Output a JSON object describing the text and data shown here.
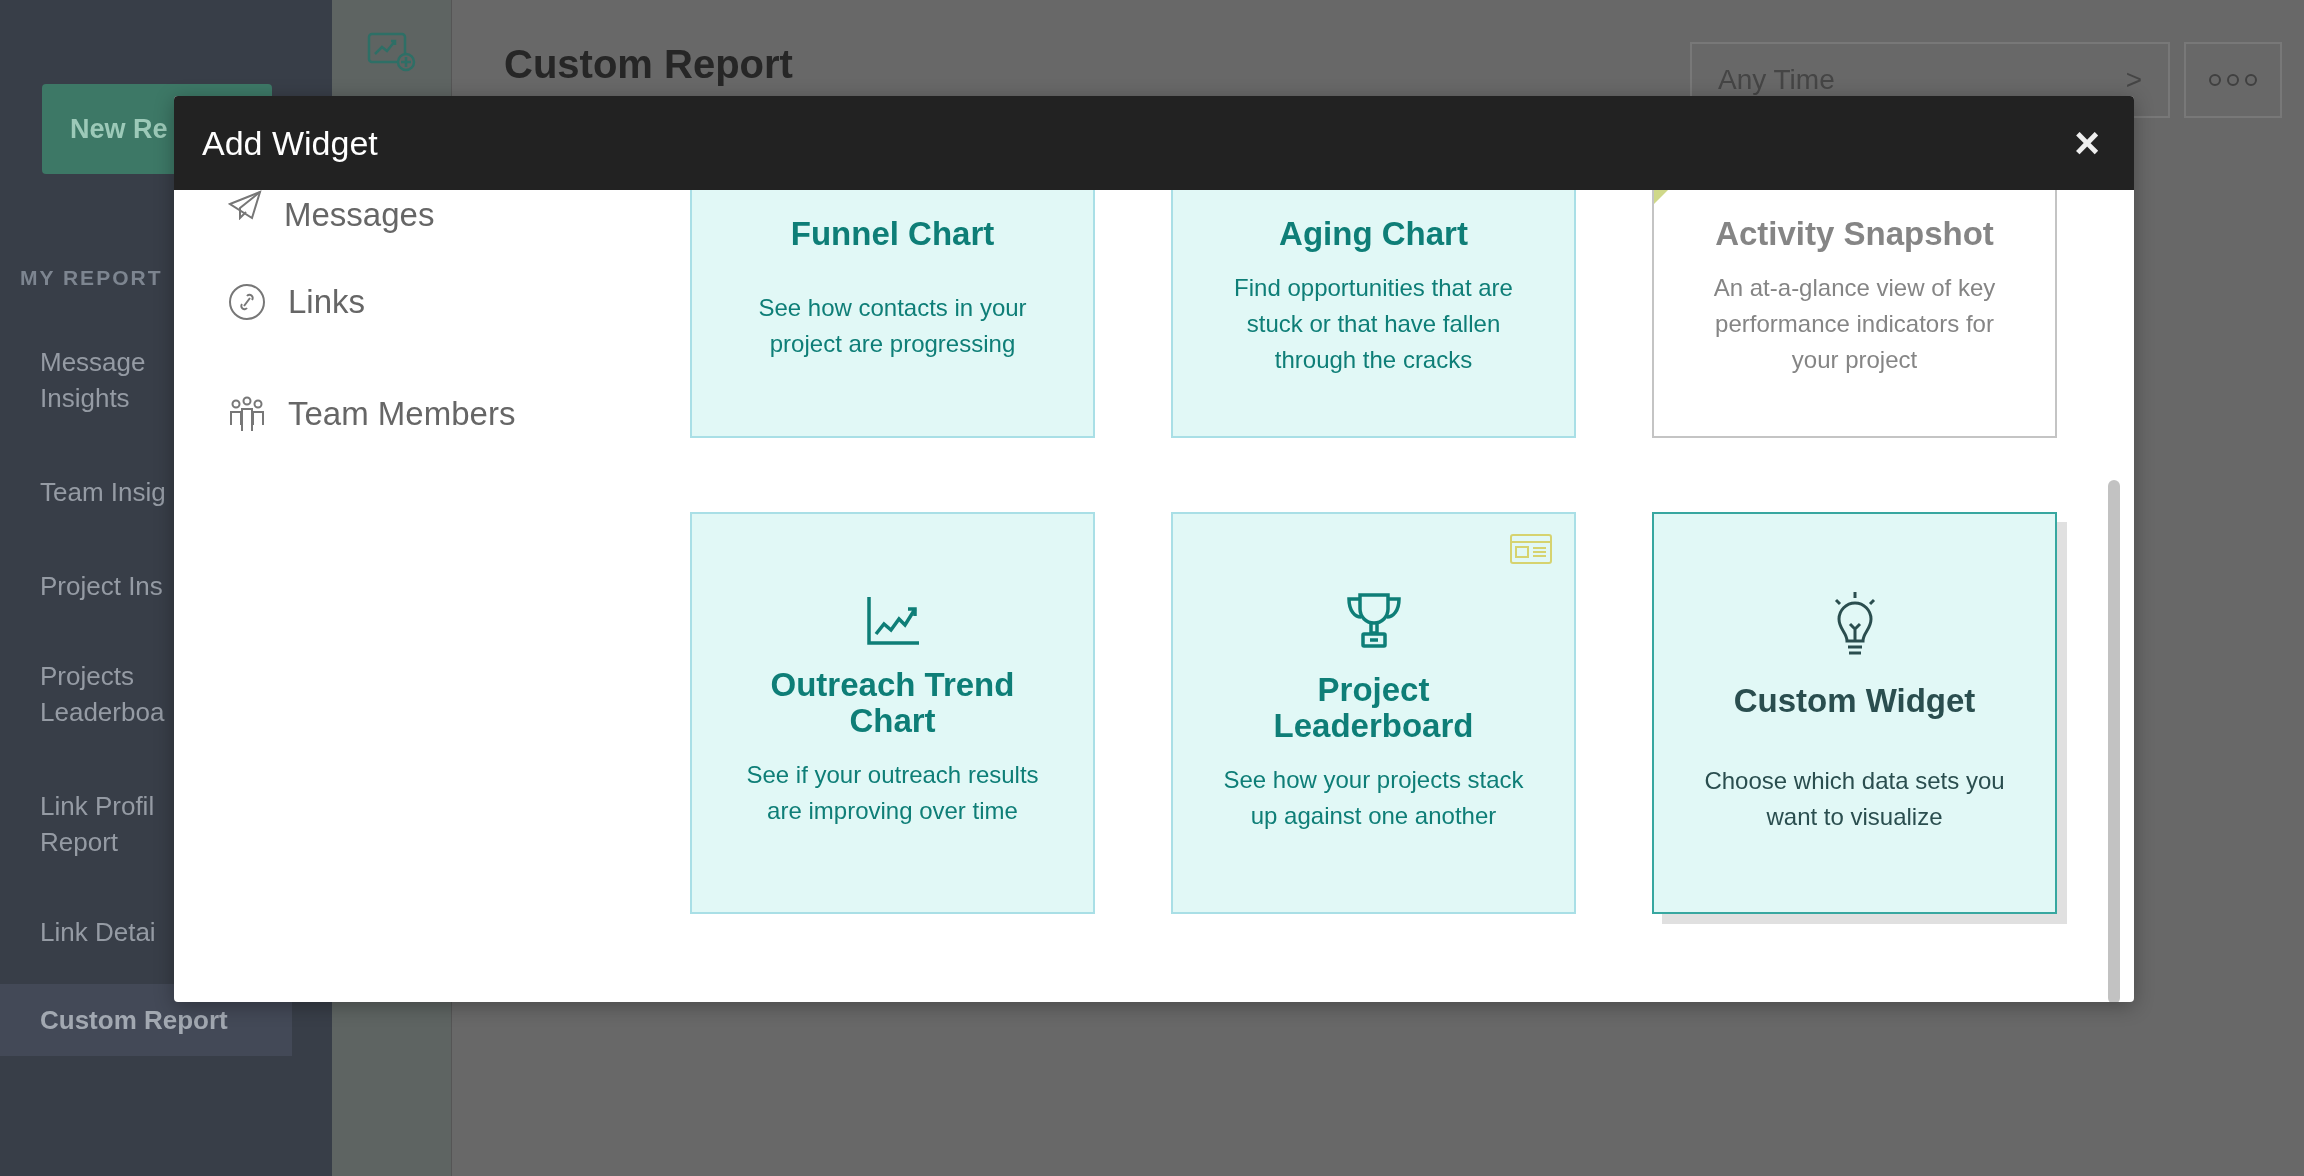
{
  "sidebar": {
    "new_button": "New Re",
    "section_label": "MY REPORT",
    "items": [
      {
        "label": "Message\nInsights",
        "selected": false
      },
      {
        "label": "Team Insig",
        "selected": false
      },
      {
        "label": "Project Ins",
        "selected": false
      },
      {
        "label": "Projects\nLeaderboa",
        "selected": false
      },
      {
        "label": "Link Profil\nReport",
        "selected": false
      },
      {
        "label": "Link Detai",
        "selected": false
      },
      {
        "label": "Custom Report",
        "selected": true
      }
    ]
  },
  "page": {
    "title": "Custom Report",
    "time_filter": "Any Time",
    "chevron": ">"
  },
  "modal": {
    "title": "Add Widget",
    "close": "×",
    "categories": [
      {
        "label": "Messages"
      },
      {
        "label": "Links"
      },
      {
        "label": "Team Members"
      }
    ],
    "cards": [
      {
        "title": "Funnel Chart",
        "description": "See how contacts in your project are progressing",
        "kind": "standard",
        "clipped": true,
        "corner_flag": false,
        "layout_badge": false
      },
      {
        "title": "Aging Chart",
        "description": "Find opportunities that are stuck or that have fallen through the cracks",
        "kind": "standard",
        "clipped": true,
        "corner_flag": false,
        "layout_badge": false
      },
      {
        "title": "Activity Snapshot",
        "description": "An at-a-glance view of key performance indicators for your project",
        "kind": "plain",
        "clipped": true,
        "corner_flag": true,
        "layout_badge": false
      },
      {
        "title": "Outreach Trend Chart",
        "description": "See if your outreach results are improving over time",
        "kind": "standard",
        "clipped": false,
        "corner_flag": false,
        "layout_badge": false
      },
      {
        "title": "Project Leaderboard",
        "description": "See how your projects stack up against one another",
        "kind": "standard",
        "clipped": false,
        "corner_flag": false,
        "layout_badge": true
      },
      {
        "title": "Custom Widget",
        "description": "Choose which data sets you want to visualize",
        "kind": "custom",
        "clipped": false,
        "corner_flag": false,
        "layout_badge": false
      }
    ]
  }
}
